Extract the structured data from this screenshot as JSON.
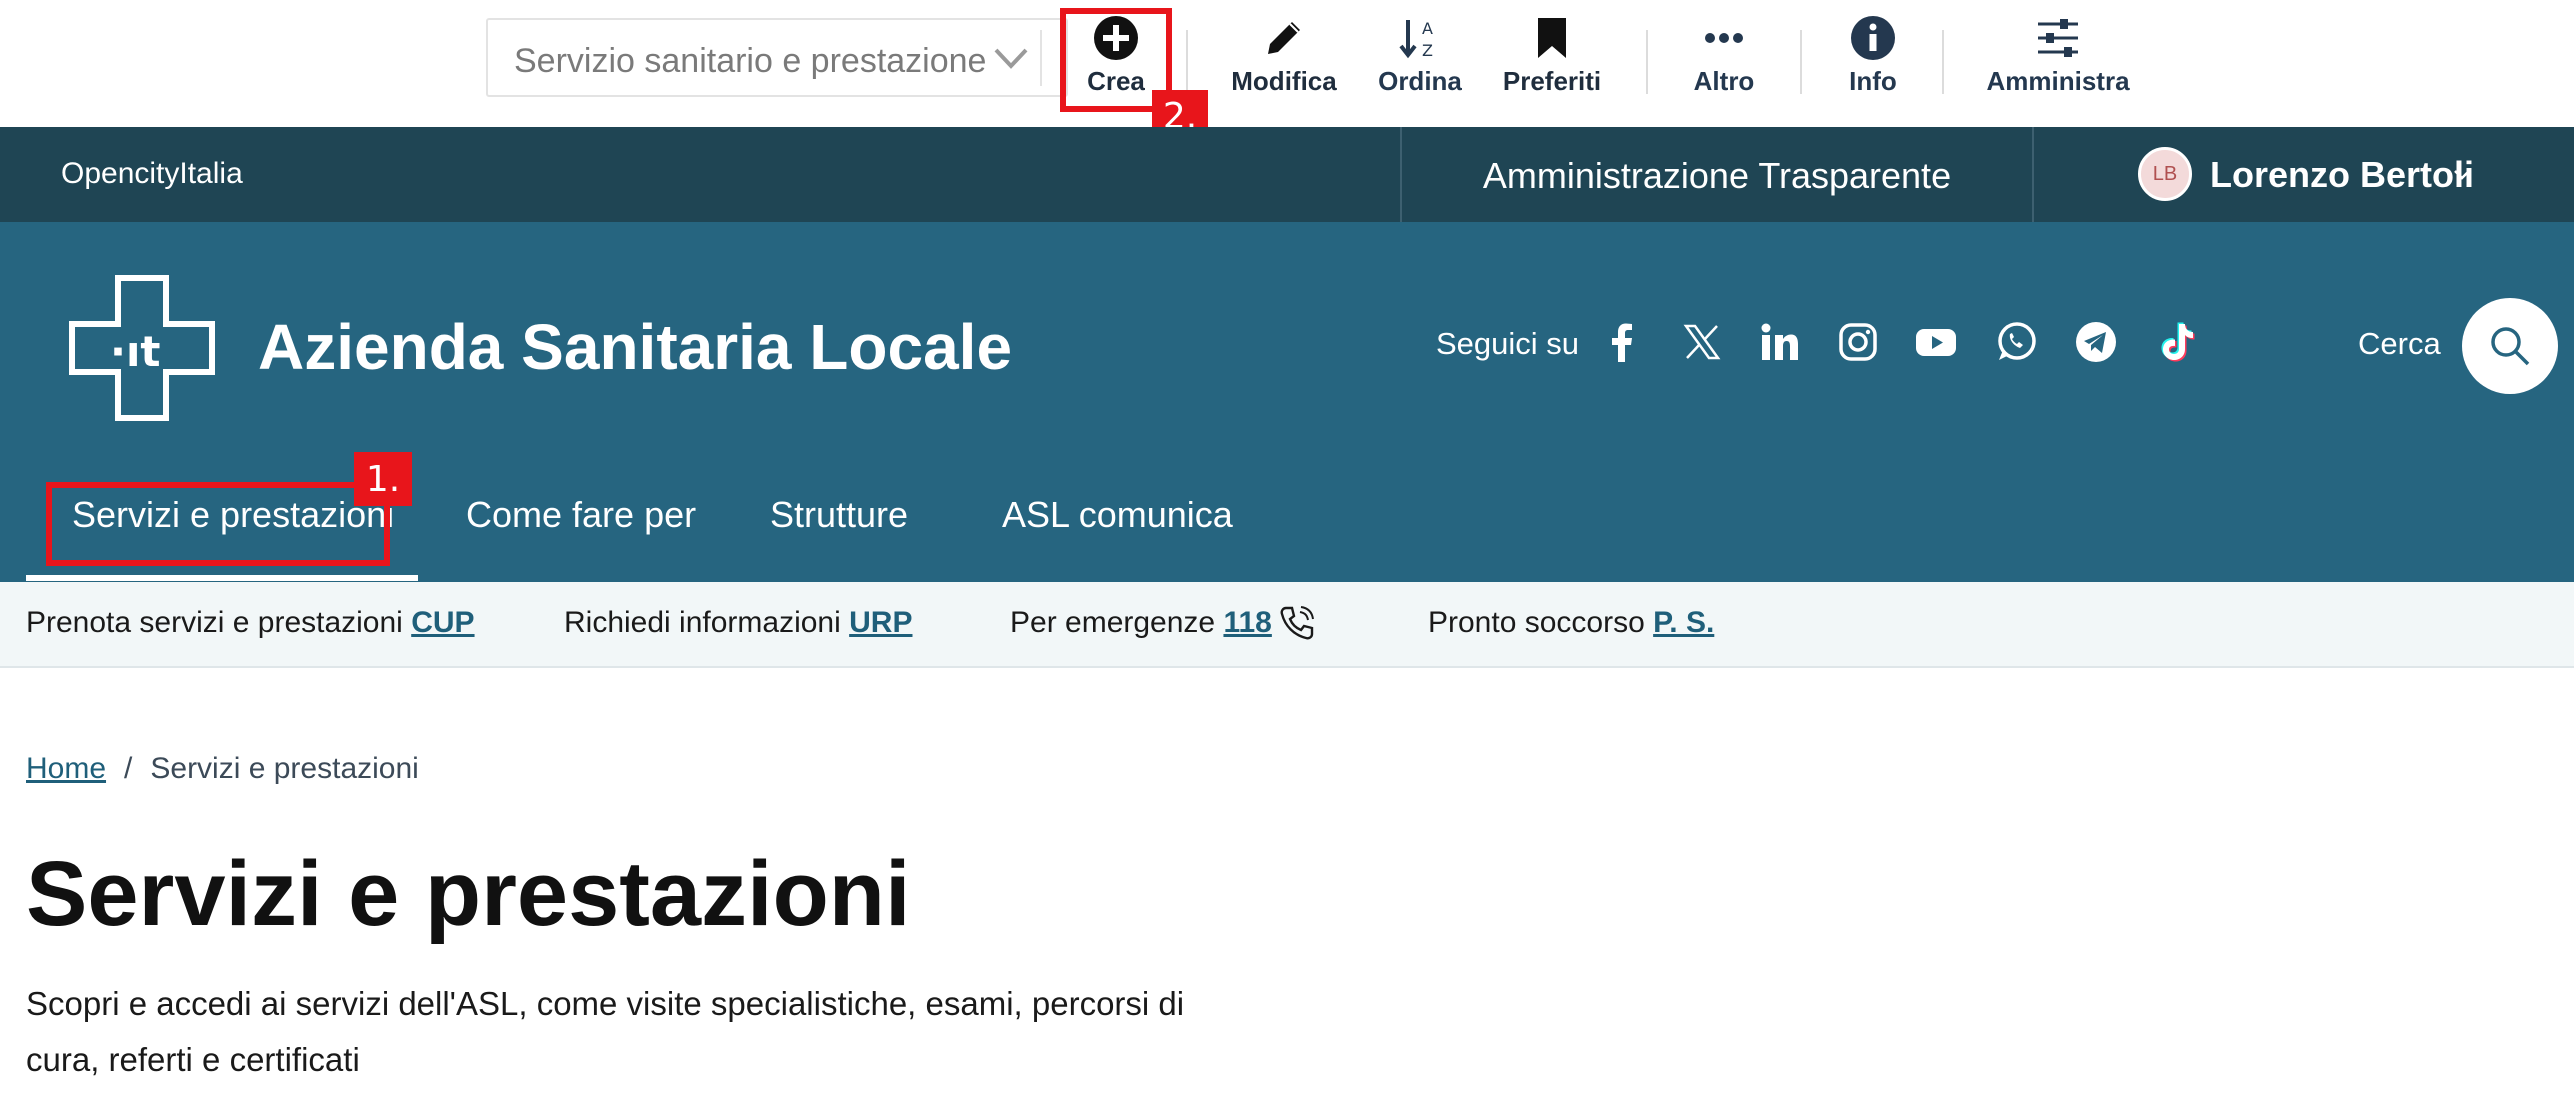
{
  "toolbar": {
    "class_select": {
      "value": "Servizio sanitario e prestazione"
    },
    "buttons": {
      "create": "Crea",
      "edit": "Modifica",
      "sort": "Ordina",
      "bookmarks": "Preferiti",
      "more": "Altro",
      "info": "Info",
      "admin": "Amministra"
    }
  },
  "annotations": {
    "first": "1.",
    "second": "2.",
    "color": "#e8151b"
  },
  "slim_header": {
    "brand": "OpencityItalia",
    "transparency": "Amministrazione Trasparente",
    "user": {
      "initials": "LB",
      "name": "Lorenzo Bertoli"
    }
  },
  "header": {
    "logo_text": "·ıt",
    "title": "Azienda Sanitaria Locale",
    "follow_label": "Seguici su",
    "social_icons": [
      "facebook-icon",
      "x-icon",
      "linkedin-icon",
      "instagram-icon",
      "youtube-icon",
      "whatsapp-icon",
      "telegram-icon",
      "tiktok-icon"
    ],
    "search_label": "Cerca"
  },
  "nav": {
    "items": [
      "Servizi e prestazioni",
      "Come fare per",
      "Strutture",
      "ASL comunica"
    ],
    "active": "Servizi e prestazioni"
  },
  "utility": {
    "items": [
      {
        "text": "Prenota servizi e prestazioni",
        "link": "CUP"
      },
      {
        "text": "Richiedi informazioni",
        "link": "URP"
      },
      {
        "text": "Per emergenze",
        "link": "118"
      },
      {
        "text": "Pronto soccorso",
        "link": "P. S."
      }
    ]
  },
  "breadcrumb": {
    "home": "Home",
    "separator": "/",
    "current": "Servizi e prestazioni"
  },
  "page": {
    "title": "Servizi e prestazioni",
    "description": "Scopri e accedi ai servizi dell'ASL, come visite specialistiche, esami, percorsi di cura, referti e certificati"
  },
  "colors": {
    "slim_header_bg": "#1f4554",
    "header_bg": "#266580",
    "utility_bg": "#f2f7f8",
    "link": "#1f5f7a"
  }
}
